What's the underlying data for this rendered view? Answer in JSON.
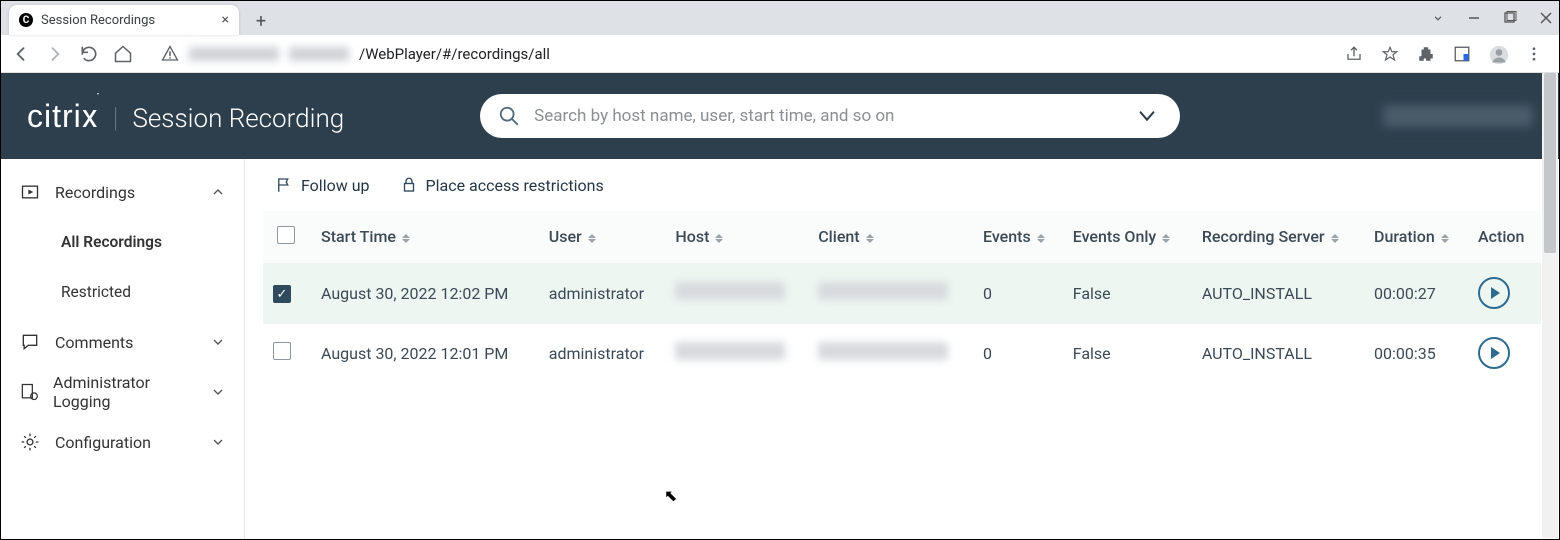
{
  "browser": {
    "tab_title": "Session Recordings",
    "favicon_letter": "C",
    "url_visible_suffix": "/WebPlayer/#/recordings/all"
  },
  "header": {
    "brand": "citrix",
    "product": "Session Recording",
    "search_placeholder": "Search by host name, user, start time, and so on"
  },
  "sidebar": {
    "recordings_label": "Recordings",
    "all_label": "All Recordings",
    "restricted_label": "Restricted",
    "comments_label": "Comments",
    "admin_logging_label": "Administrator Logging",
    "config_label": "Configuration"
  },
  "toolbar": {
    "follow_up_label": "Follow up",
    "restrict_label": "Place access restrictions"
  },
  "table": {
    "columns": {
      "start_time": "Start Time",
      "user": "User",
      "host": "Host",
      "client": "Client",
      "events": "Events",
      "events_only": "Events Only",
      "recording_server": "Recording Server",
      "duration": "Duration",
      "action": "Action"
    },
    "rows": [
      {
        "selected": true,
        "start_time": "August 30, 2022 12:02 PM",
        "user": "administrator",
        "events": "0",
        "events_only": "False",
        "recording_server": "AUTO_INSTALL",
        "duration": "00:00:27"
      },
      {
        "selected": false,
        "start_time": "August 30, 2022 12:01 PM",
        "user": "administrator",
        "events": "0",
        "events_only": "False",
        "recording_server": "AUTO_INSTALL",
        "duration": "00:00:35"
      }
    ]
  }
}
